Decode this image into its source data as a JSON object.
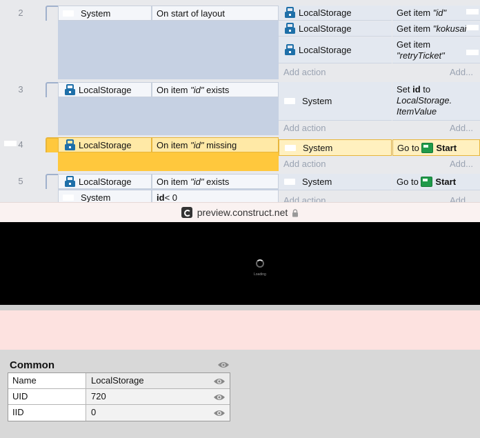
{
  "event_sheet": {
    "events": [
      {
        "number": "2",
        "condition_object": "System",
        "condition_text": "On start of layout",
        "actions": [
          {
            "object": "LocalStorage",
            "pre": "Get item ",
            "quoted": "\"id\""
          },
          {
            "object": "LocalStorage",
            "pre": "Get item ",
            "quoted": "\"kokusai"
          },
          {
            "object": "LocalStorage",
            "pre": "Get item",
            "quoted": "\"retryTicket\""
          }
        ],
        "add_action": "Add action",
        "add_more": "Add..."
      },
      {
        "number": "3",
        "condition_object": "LocalStorage",
        "condition_pre": "On item ",
        "condition_quoted": "\"id\"",
        "condition_post": " exists",
        "action_object": "System",
        "action_set": "Set ",
        "action_var": "id",
        "action_to": " to",
        "action_expr1": "LocalStorage.",
        "action_expr2": "ItemValue",
        "add_action": "Add action",
        "add_more": "Add..."
      },
      {
        "number": "4",
        "condition_object": "LocalStorage",
        "condition_pre": "On item ",
        "condition_quoted": "\"id\"",
        "condition_post": " missing",
        "action_object": "System",
        "action_goto": "Go to ",
        "action_target": "Start",
        "add_action": "Add action",
        "add_more": "Add..."
      },
      {
        "number": "5",
        "condition_object": "LocalStorage",
        "condition_pre": "On item ",
        "condition_quoted": "\"id\"",
        "condition_post": " exists",
        "condition2_object": "System",
        "condition2_var": "id",
        "condition2_rest": " < 0",
        "action_object": "System",
        "action_goto": "Go to ",
        "action_target": "Start",
        "add_action": "Add action",
        "add_more": "Add..."
      }
    ]
  },
  "address_bar": {
    "url": "preview.construct.net"
  },
  "preview": {
    "loading_text": "Loading"
  },
  "properties": {
    "section_title": "Common",
    "rows": [
      {
        "name": "Name",
        "value": "LocalStorage"
      },
      {
        "name": "UID",
        "value": "720"
      },
      {
        "name": "IID",
        "value": "0"
      }
    ]
  },
  "colors": {
    "highlight": "#ffc83d",
    "event_block": "#c6d1e3",
    "icon_blue": "#1e6fa8",
    "preview_bg": "#000000"
  },
  "icons": [
    "localstorage-icon",
    "layout-icon",
    "eye-icon",
    "lock-icon",
    "construct-logo"
  ]
}
